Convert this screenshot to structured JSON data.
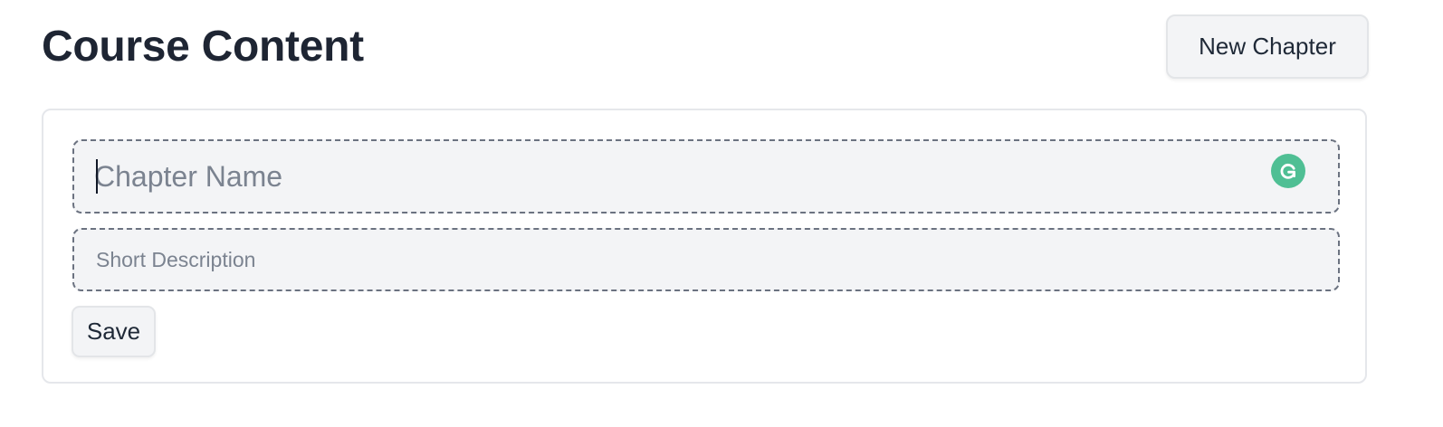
{
  "header": {
    "title": "Course Content",
    "new_chapter_label": "New Chapter"
  },
  "form": {
    "chapter_name": {
      "value": "",
      "placeholder": "Chapter Name"
    },
    "short_description": {
      "value": "",
      "placeholder": "Short Description"
    },
    "save_label": "Save"
  },
  "icons": {
    "grammarly": "grammarly-icon"
  },
  "colors": {
    "title": "#1e2533",
    "button_bg": "#f3f4f6",
    "field_bg": "#f3f4f6",
    "field_border": "#6b7280",
    "placeholder": "#7b8390",
    "grammarly": "#4fbf94"
  }
}
